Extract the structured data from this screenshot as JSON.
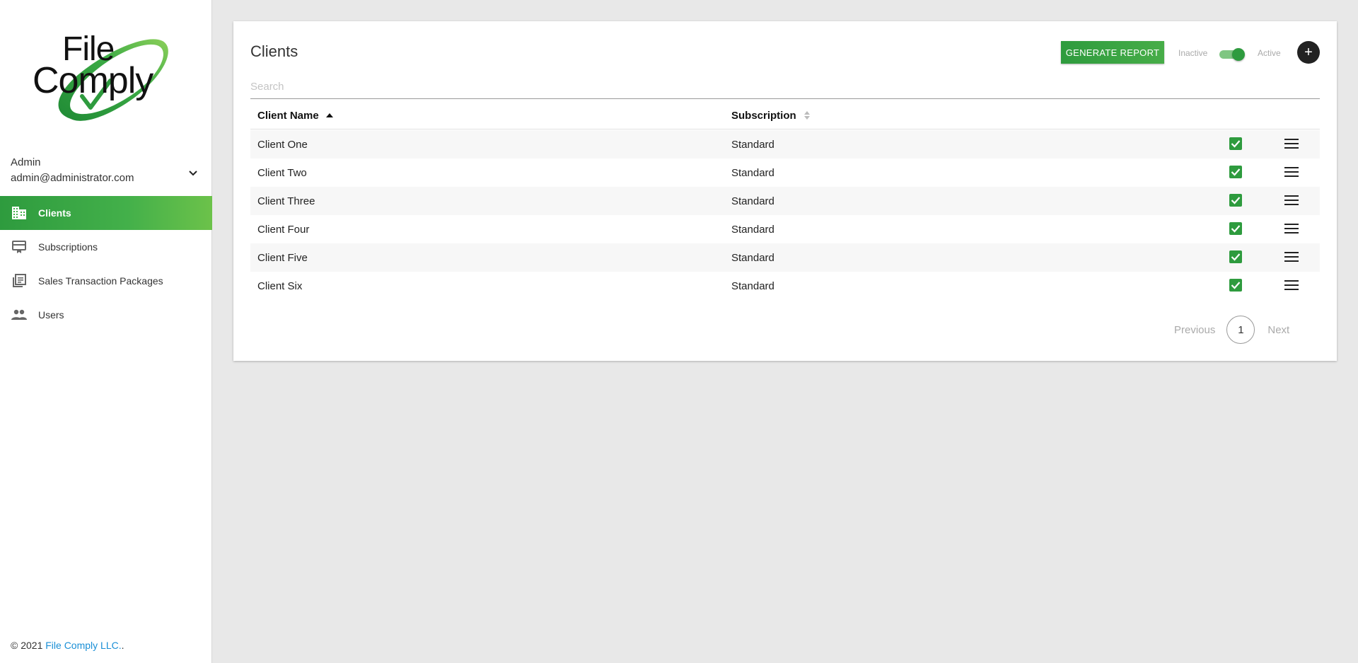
{
  "brand": {
    "logo_line1": "File",
    "logo_line2": "Comply",
    "accent_color": "#2e9b3e"
  },
  "user": {
    "name": "Admin",
    "email": "admin@administrator.com",
    "toggle_icon": "chevron-down-icon"
  },
  "sidebar": {
    "items": [
      {
        "label": "Clients",
        "icon": "building-icon",
        "active": true
      },
      {
        "label": "Subscriptions",
        "icon": "subscription-card-icon",
        "active": false
      },
      {
        "label": "Sales Transaction Packages",
        "icon": "library-books-icon",
        "active": false
      },
      {
        "label": "Users",
        "icon": "people-icon",
        "active": false
      }
    ]
  },
  "footer": {
    "copyright": "© 2021 ",
    "company_link": "File Comply LLC.",
    "suffix": "."
  },
  "main": {
    "title": "Clients",
    "search_placeholder": "Search",
    "generate_report_label": "GENERATE REPORT",
    "inactive_label": "Inactive",
    "active_label": "Active",
    "toggle_on": true,
    "add_label": "+",
    "table": {
      "columns": [
        "Client Name",
        "Subscription"
      ],
      "sort": {
        "column": "Client Name",
        "direction": "ascending"
      },
      "rows": [
        {
          "name": "Client One",
          "subscription": "Standard",
          "active": true
        },
        {
          "name": "Client Two",
          "subscription": "Standard",
          "active": true
        },
        {
          "name": "Client Three",
          "subscription": "Standard",
          "active": true
        },
        {
          "name": "Client Four",
          "subscription": "Standard",
          "active": true
        },
        {
          "name": "Client Five",
          "subscription": "Standard",
          "active": true
        },
        {
          "name": "Client Six",
          "subscription": "Standard",
          "active": true
        }
      ]
    },
    "pagination": {
      "previous_label": "Previous",
      "current_page": "1",
      "next_label": "Next"
    }
  }
}
